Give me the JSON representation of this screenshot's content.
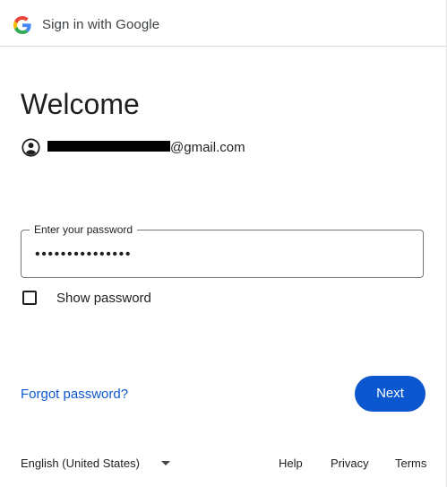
{
  "header": {
    "title": "Sign in with Google",
    "logo_icon": "google-g-icon"
  },
  "main": {
    "heading": "Welcome",
    "account": {
      "icon": "account-circle-icon",
      "email_visible": "@gmail.com"
    },
    "password": {
      "label": "Enter your password",
      "value": "•••••••••••••••"
    },
    "show_password": {
      "label": "Show password",
      "checked": false
    },
    "forgot_label": "Forgot password?",
    "next_label": "Next"
  },
  "footer": {
    "language": "English (United States)",
    "help": "Help",
    "privacy": "Privacy",
    "terms": "Terms"
  },
  "colors": {
    "primary": "#0b57d0",
    "text": "#1f1f1f",
    "divider": "#dadce0"
  }
}
